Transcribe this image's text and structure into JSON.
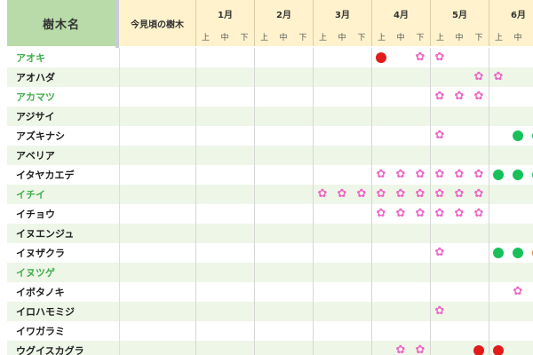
{
  "header": {
    "name_label": "樹木名",
    "now_label": "今見頃の樹木",
    "months": [
      "1月",
      "2月",
      "3月",
      "4月",
      "5月",
      "6月"
    ],
    "subperiods": [
      "上",
      "中",
      "下"
    ]
  },
  "colors": {
    "name_header_bg": "#b9dba9",
    "month_header_bg": "#fff2cc",
    "row_alt_bg": "#eef6e8",
    "name_green": "#3fae49",
    "name_black": "#222222",
    "flower": "#ee66c6",
    "red_dot": "#e21b1b",
    "green_dot": "#18c05a",
    "orange_dot": "#f07a2a"
  },
  "legend_icons": {
    "flower": "cherry-blossom-icon",
    "red": "red-dot-icon",
    "green": "green-dot-icon",
    "orange": "orange-dot-icon"
  },
  "trees": [
    {
      "name": "アオキ",
      "color": "green",
      "marks": [
        [
          "red",
          9
        ],
        [
          "flower",
          11
        ],
        [
          "flower",
          12
        ]
      ]
    },
    {
      "name": "アオハダ",
      "color": "black",
      "marks": [
        [
          "flower",
          14
        ],
        [
          "flower",
          15
        ]
      ]
    },
    {
      "name": "アカマツ",
      "color": "green",
      "marks": [
        [
          "flower",
          12
        ],
        [
          "flower",
          13
        ],
        [
          "flower",
          14
        ]
      ]
    },
    {
      "name": "アジサイ",
      "color": "black",
      "marks": [
        [
          "flower",
          17
        ]
      ]
    },
    {
      "name": "アズキナシ",
      "color": "black",
      "marks": [
        [
          "flower",
          12
        ],
        [
          "green",
          16
        ],
        [
          "green",
          17
        ]
      ]
    },
    {
      "name": "アベリア",
      "color": "black",
      "marks": []
    },
    {
      "name": "イタヤカエデ",
      "color": "black",
      "marks": [
        [
          "flower",
          9
        ],
        [
          "flower",
          10
        ],
        [
          "flower",
          11
        ],
        [
          "flower",
          12
        ],
        [
          "flower",
          13
        ],
        [
          "flower",
          14
        ],
        [
          "green",
          15
        ],
        [
          "green",
          16
        ],
        [
          "green",
          17
        ]
      ]
    },
    {
      "name": "イチイ",
      "color": "green",
      "marks": [
        [
          "flower",
          6
        ],
        [
          "flower",
          7
        ],
        [
          "flower",
          8
        ],
        [
          "flower",
          9
        ],
        [
          "flower",
          10
        ],
        [
          "flower",
          11
        ],
        [
          "flower",
          12
        ],
        [
          "flower",
          13
        ],
        [
          "flower",
          14
        ]
      ]
    },
    {
      "name": "イチョウ",
      "color": "black",
      "marks": [
        [
          "flower",
          9
        ],
        [
          "flower",
          10
        ],
        [
          "flower",
          11
        ],
        [
          "flower",
          12
        ],
        [
          "flower",
          13
        ],
        [
          "flower",
          14
        ]
      ]
    },
    {
      "name": "イヌエンジュ",
      "color": "black",
      "marks": []
    },
    {
      "name": "イヌザクラ",
      "color": "black",
      "marks": [
        [
          "flower",
          12
        ],
        [
          "green",
          15
        ],
        [
          "green",
          16
        ],
        [
          "orange",
          17
        ]
      ]
    },
    {
      "name": "イヌツゲ",
      "color": "green",
      "marks": []
    },
    {
      "name": "イボタノキ",
      "color": "black",
      "marks": [
        [
          "flower",
          16
        ],
        [
          "flower",
          17
        ]
      ]
    },
    {
      "name": "イロハモミジ",
      "color": "black",
      "marks": [
        [
          "flower",
          12
        ]
      ]
    },
    {
      "name": "イワガラミ",
      "color": "black",
      "marks": [
        [
          "flower",
          17
        ]
      ]
    },
    {
      "name": "ウグイスカグラ",
      "color": "black",
      "marks": [
        [
          "flower",
          10
        ],
        [
          "flower",
          11
        ],
        [
          "red",
          14
        ],
        [
          "red",
          15
        ]
      ]
    }
  ]
}
